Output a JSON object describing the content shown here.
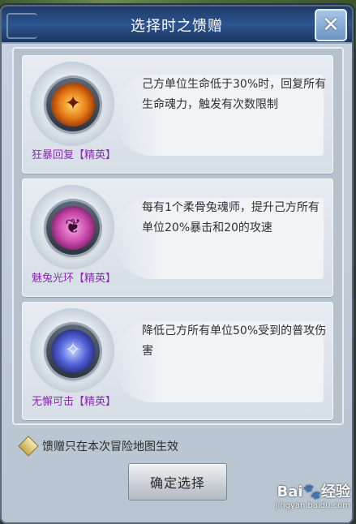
{
  "dialog": {
    "title": "选择时之馈赠",
    "close_glyph": "✕"
  },
  "cards": [
    {
      "name": "狂暴回复【精英】",
      "description": "己方单位生命低于30%时，回复所有生命魂力，触发有次数限制",
      "icon": "berserk-recovery-icon"
    },
    {
      "name": "魅兔光环【精英】",
      "description": "每有1个柔骨兔魂师，提升己方所有单位20%暴击和20的攻速",
      "icon": "charm-rabbit-aura-icon"
    },
    {
      "name": "无懈可击【精英】",
      "description": "降低己方所有单位50%受到的普攻伤害",
      "icon": "invulnerable-icon"
    }
  ],
  "footer": {
    "note": "馈赠只在本次冒险地图生效",
    "confirm_label": "确定选择"
  },
  "watermark": {
    "brand": "Bai",
    "brand2": "经验",
    "url": "jingyan.baidu.com"
  }
}
